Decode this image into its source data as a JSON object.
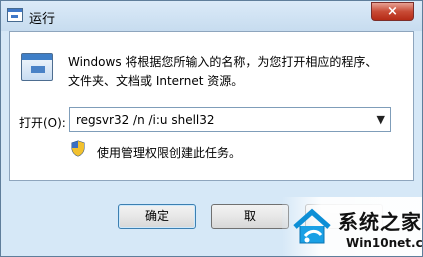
{
  "window": {
    "title": "运行",
    "close_symbol": "×"
  },
  "content": {
    "description_line1": "Windows 将根据您所输入的名称，为您打开相应的程序、",
    "description_line2": "文件夹、文档或 Internet 资源。",
    "open_label": "打开(O):",
    "command_value": "regsvr32 /n /i:u shell32",
    "dropdown_arrow": "▼",
    "admin_note": "使用管理权限创建此任务。"
  },
  "buttons": {
    "ok": "确定",
    "cancel": "取",
    "browse": ""
  },
  "watermark": {
    "title": "系统之家",
    "url": "Win10net.com"
  },
  "icons": {
    "title": "run-window-icon",
    "content": "run-window-icon",
    "admin": "uac-shield-icon",
    "watermark_logo": "house-logo-icon"
  },
  "colors": {
    "window_bg": "#d6e8f7",
    "content_bg": "#ffffff",
    "close_red": "#c84b36",
    "accent_blue": "#3f7fc7"
  }
}
